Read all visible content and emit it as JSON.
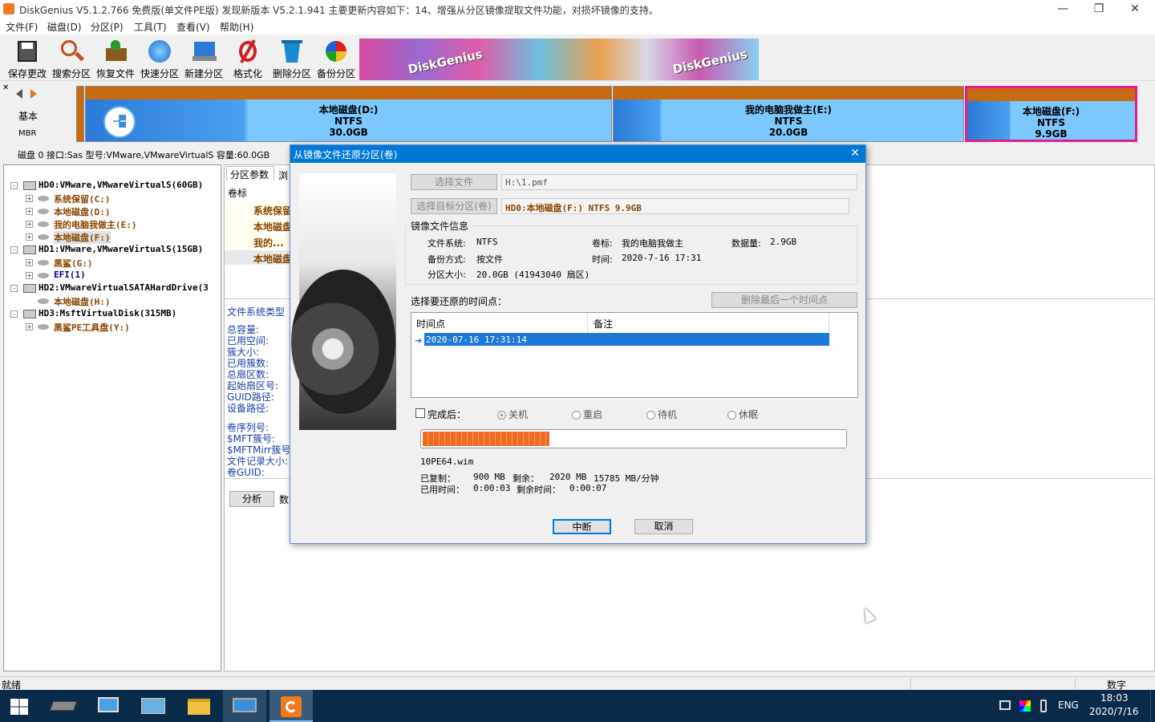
{
  "app": {
    "title": "DiskGenius V5.1.2.766 免费版(单文件PE版)   发现新版本 V5.2.1.941 主要更新内容如下：14、增强从分区镜像提取文件功能，对损坏镜像的支持。"
  },
  "menu": [
    "文件(F)",
    "磁盘(D)",
    "分区(P)",
    "工具(T)",
    "查看(V)",
    "帮助(H)"
  ],
  "toolbar": {
    "save": "保存更改",
    "search": "搜索分区",
    "recover": "恢复文件",
    "quick": "快速分区",
    "new": "新建分区",
    "format": "格式化",
    "delete": "删除分区",
    "backup": "备份分区"
  },
  "banner": {
    "text1": "DiskGenius",
    "text2": "DiskGenius"
  },
  "disknav": {
    "basic": "基本",
    "mbr": "MBR"
  },
  "partitions": [
    {
      "name": "本地磁盘(D:)",
      "fs": "NTFS",
      "size": "30.0GB"
    },
    {
      "name": "我的电脑我做主(E:)",
      "fs": "NTFS",
      "size": "20.0GB"
    },
    {
      "name": "本地磁盘(F:)",
      "fs": "NTFS",
      "size": "9.9GB"
    }
  ],
  "diskinfo": "磁盘 0 接口:Sas  型号:VMware,VMwareVirtualS  容量:60.0GB",
  "tree": [
    {
      "label": "HD0:VMware,VMwareVirtualS(60GB)"
    },
    {
      "label": "系统保留(C:)"
    },
    {
      "label": "本地磁盘(D:)"
    },
    {
      "label": "我的电脑我做主(E:)"
    },
    {
      "label": "本地磁盘(F:)"
    },
    {
      "label": "HD1:VMware,VMwareVirtualS(15GB)"
    },
    {
      "label": "黑鲨(G:)"
    },
    {
      "label": "EFI(1)"
    },
    {
      "label": "HD2:VMwareVirtualSATAHardDrive(3"
    },
    {
      "label": "本地磁盘(H:)"
    },
    {
      "label": "HD3:MsftVirtualDisk(315MB)"
    },
    {
      "label": "黑鲨PE工具盘(Y:)"
    }
  ],
  "rightpane": {
    "tab1": "分区参数",
    "tab2": "浏",
    "col_label": "卷标",
    "rows": [
      "系统保留",
      "本地磁盘",
      "我的...",
      "本地磁盘"
    ],
    "fstype": "文件系统类型",
    "fields": [
      "总容量:",
      "已用空间:",
      "簇大小:",
      "已用簇数:",
      "总扇区数:",
      "起始扇区号:",
      "GUID路径:",
      "设备路径:"
    ],
    "fields2": [
      "卷序列号:",
      "$MFT簇号:",
      "$MFTMirr簇号:",
      "文件记录大小:",
      "卷GUID:"
    ],
    "analyze": "分析",
    "data": "数"
  },
  "dialog": {
    "title": "从镜像文件还原分区(卷)",
    "select_file": "选择文件",
    "file_path": "H:\\1.pmf",
    "select_target": "选择目标分区(卷)",
    "target_value": "HD0:本地磁盘(F:) NTFS 9.9GB",
    "info_group": "镜像文件信息",
    "fs_label": "文件系统:",
    "fs_value": "NTFS",
    "vol_label": "卷标:",
    "vol_value": "我的电脑我做主",
    "data_label": "数据量:",
    "data_value": "2.9GB",
    "backup_label": "备份方式:",
    "backup_value": "按文件",
    "time_label": "时间:",
    "time_value": "2020-7-16 17:31",
    "size_label": "分区大小:",
    "size_value": "20.0GB  (41943040 扇区)",
    "select_point": "选择要还原的时间点：",
    "delete_last": "删除最后一个时间点",
    "col_time": "时间点",
    "col_note": "备注",
    "point_value": "2020-07-16 17:31:14",
    "after_label": "完成后：",
    "opt_shutdown": "关机",
    "opt_restart": "重启",
    "opt_standby": "待机",
    "opt_hibernate": "休眠",
    "progress": 0.3,
    "current_file": "10PE64.wim",
    "copied_label": "已复制：",
    "copied_value": "900 MB",
    "remain_label": "剩余：",
    "remain_value": "2020 MB",
    "speed": "15785 MB/分钟",
    "elapsed_label": "已用时间：",
    "elapsed_value": "0:00:03",
    "left_label": "剩余时间：",
    "left_value": "0:00:07",
    "interrupt": "中断",
    "cancel": "取消"
  },
  "status": {
    "ready": "就绪",
    "numlock": "数字"
  },
  "taskbar": {
    "lang": "ENG",
    "time": "18:03",
    "date": "2020/7/16"
  }
}
